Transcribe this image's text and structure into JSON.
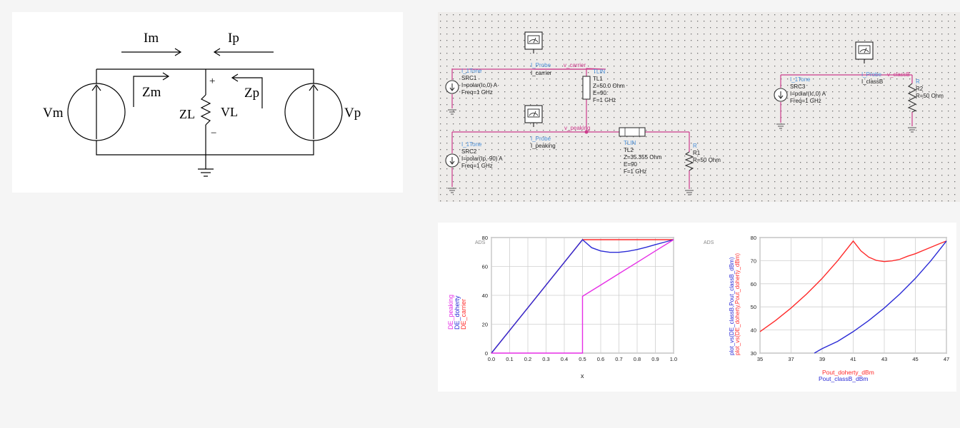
{
  "circuit": {
    "Im": "Im",
    "Ip": "Ip",
    "Zm": "Zm",
    "Zp": "Zp",
    "Vm": "Vm",
    "Vp": "Vp",
    "ZL": "ZL",
    "VL": "VL",
    "plus": "+",
    "minus": "−"
  },
  "schematic": {
    "src1": {
      "type": "I_1Tone",
      "name": "SRC1",
      "value": "I=polar(Ic,0) A",
      "freq": "Freq=1 GHz"
    },
    "src2": {
      "type": "I_1Tone",
      "name": "SRC2",
      "value": "I=polar(Ip,-90) A",
      "freq": "Freq=1 GHz"
    },
    "src3": {
      "type": "I_1Tone",
      "name": "SRC3",
      "value": "I=polar(Ic,0) A",
      "freq": "Freq=1 GHz"
    },
    "probe_carrier": {
      "type": "I_Probe",
      "name": "I_carrier"
    },
    "probe_peaking": {
      "type": "I_Probe",
      "name": "I_peaking"
    },
    "probe_classB": {
      "type": "I_Probe",
      "name": "I_classB"
    },
    "v_carrier": "v_carrier",
    "v_peaking": "v_peaking",
    "v_classB": "v_classB",
    "tl1": {
      "type": "TLIN",
      "name": "TL1",
      "z": "Z=50.0 Ohm",
      "e": "E=90.",
      "f": "F=1 GHz"
    },
    "tl2": {
      "type": "TLIN",
      "name": "TL2",
      "z": "Z=35.355 Ohm",
      "e": "E=90",
      "f": "F=1 GHz"
    },
    "r1": {
      "type": "R",
      "name": "R1",
      "value": "R=50 Ohm"
    },
    "r2": {
      "type": "R",
      "name": "R2",
      "value": "R=50 Ohm"
    }
  },
  "chart_data": [
    {
      "type": "line",
      "corner_label": "ADS",
      "xlabel": "x",
      "ylabels": [
        "DE_peaking",
        "DE_doherty",
        "DE_carrier"
      ],
      "xlim": [
        0.0,
        1.0
      ],
      "ylim": [
        0,
        80
      ],
      "xticks": [
        "0.0",
        "0.1",
        "0.2",
        "0.3",
        "0.4",
        "0.5",
        "0.6",
        "0.7",
        "0.8",
        "0.9",
        "1.0"
      ],
      "yticks": [
        "0",
        "20",
        "40",
        "60",
        "80"
      ],
      "grid": true,
      "colors": {
        "DE_carrier": "#ff2a2a",
        "DE_doherty": "#2b2bd6",
        "DE_peaking": "#e62ee6"
      },
      "series": [
        {
          "name": "DE_carrier",
          "x": [
            0,
            0.1,
            0.2,
            0.3,
            0.4,
            0.5,
            0.6,
            0.7,
            0.8,
            0.9,
            1.0
          ],
          "y": [
            0,
            15.7,
            31.4,
            47.1,
            62.8,
            78.5,
            78.5,
            78.5,
            78.5,
            78.5,
            78.5
          ]
        },
        {
          "name": "DE_doherty",
          "x": [
            0,
            0.1,
            0.2,
            0.3,
            0.4,
            0.5,
            0.55,
            0.6,
            0.65,
            0.7,
            0.75,
            0.8,
            0.85,
            0.9,
            0.95,
            1.0
          ],
          "y": [
            0,
            15.7,
            31.4,
            47.1,
            62.8,
            78.5,
            73.0,
            70.7,
            69.8,
            69.8,
            70.5,
            71.7,
            73.3,
            75.1,
            76.8,
            78.5
          ]
        },
        {
          "name": "DE_peaking",
          "x": [
            0,
            0.49,
            0.5,
            0.5,
            0.6,
            0.7,
            0.8,
            0.9,
            1.0
          ],
          "y": [
            0,
            0,
            0,
            39.3,
            47.1,
            55.0,
            62.8,
            70.7,
            78.5
          ]
        }
      ]
    },
    {
      "type": "line",
      "corner_label": "ADS",
      "xlabels": [
        "Pout_doherty_dBm",
        "Pout_classB_dBm"
      ],
      "ylabels": [
        "plot_vs(DE_classB,Pout_classB_dBm)",
        "plot_vs(DE_doherty,Pout_doherty_dBm)"
      ],
      "xlim": [
        35,
        47
      ],
      "ylim": [
        30,
        80
      ],
      "xticks": [
        "35",
        "37",
        "39",
        "41",
        "43",
        "45",
        "47"
      ],
      "yticks": [
        "30",
        "40",
        "50",
        "60",
        "70",
        "80"
      ],
      "grid": true,
      "colors": {
        "doherty": "#ff2a2a",
        "classB": "#2b2bd6"
      },
      "series": [
        {
          "name": "doherty",
          "x": [
            35,
            36,
            37,
            38,
            39,
            40,
            41,
            41.5,
            42,
            42.5,
            43,
            43.5,
            44,
            44.5,
            45,
            45.5,
            46,
            46.5,
            47
          ],
          "y": [
            39.3,
            44.1,
            49.5,
            55.6,
            62.3,
            70.0,
            78.5,
            74.2,
            71.5,
            70.1,
            69.6,
            69.9,
            70.6,
            71.9,
            73.0,
            74.4,
            75.8,
            77.2,
            78.5
          ]
        },
        {
          "name": "classB",
          "x": [
            38.5,
            39,
            40,
            41,
            42,
            43,
            44,
            45,
            46,
            47
          ],
          "y": [
            30,
            31.9,
            35.1,
            39.3,
            44.1,
            49.5,
            55.6,
            62.3,
            70.0,
            78.5
          ]
        }
      ]
    }
  ]
}
